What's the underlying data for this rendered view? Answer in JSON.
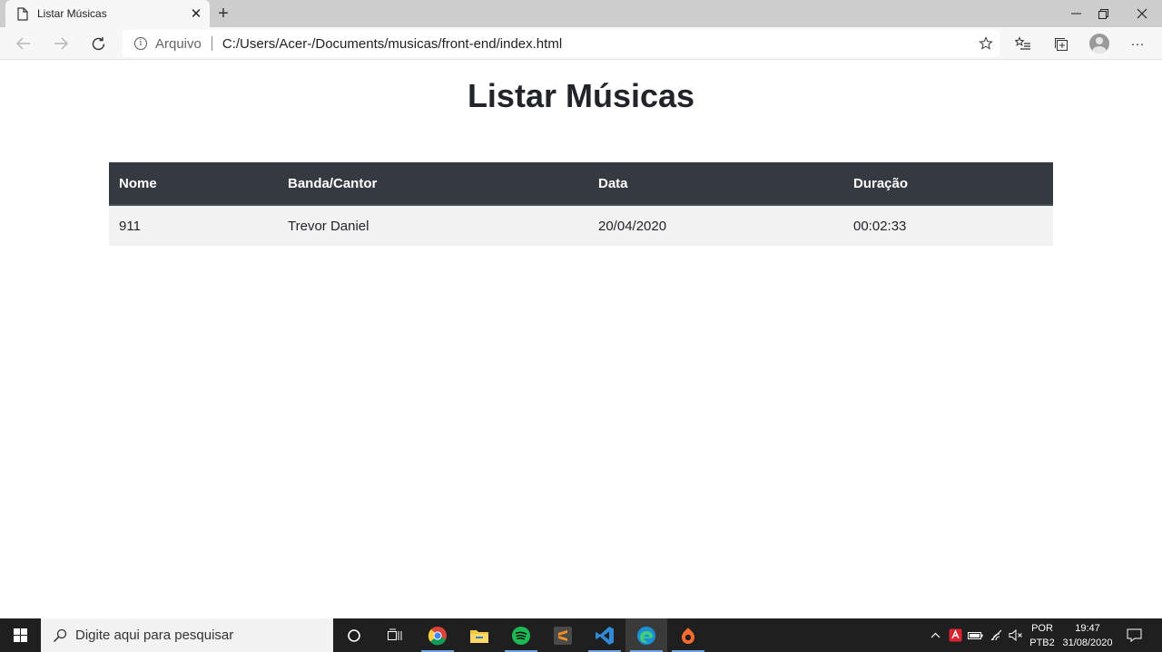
{
  "browser": {
    "tab_title": "Listar Músicas",
    "tab_close": "✕",
    "new_tab": "+",
    "window_controls": {
      "minimize": "—",
      "restore": "❐",
      "close": "✕"
    },
    "address": {
      "scheme_label": "Arquivo",
      "url": "C:/Users/Acer-/Documents/musicas/front-end/index.html"
    },
    "toolbar_icons": [
      "back-icon",
      "forward-icon",
      "refresh-icon",
      "info-icon",
      "favorite-star-icon",
      "favorites-list-icon",
      "collections-icon",
      "profile-avatar",
      "more-options-icon"
    ],
    "more_label": "···"
  },
  "page": {
    "title": "Listar Músicas",
    "table": {
      "headers": [
        "Nome",
        "Banda/Cantor",
        "Data",
        "Duração"
      ],
      "rows": [
        [
          "911",
          "Trevor Daniel",
          "20/04/2020",
          "00:02:33"
        ]
      ]
    }
  },
  "taskbar": {
    "search_placeholder": "Digite aqui para pesquisar",
    "apps": [
      "cortana-icon",
      "task-view-icon",
      "chrome-icon",
      "file-explorer-icon",
      "spotify-icon",
      "sublime-text-icon",
      "vscode-icon",
      "edge-icon",
      "origin-icon"
    ],
    "active_app": "edge-icon",
    "language": {
      "line1": "POR",
      "line2": "PTB2"
    },
    "clock": {
      "time": "19:47",
      "date": "31/08/2020"
    }
  },
  "colors": {
    "table_header_bg": "#343a40",
    "table_row_bg": "#f2f2f2",
    "tabstrip_bg": "#cdcdcd",
    "taskbar_bg": "#1f1f1f"
  }
}
